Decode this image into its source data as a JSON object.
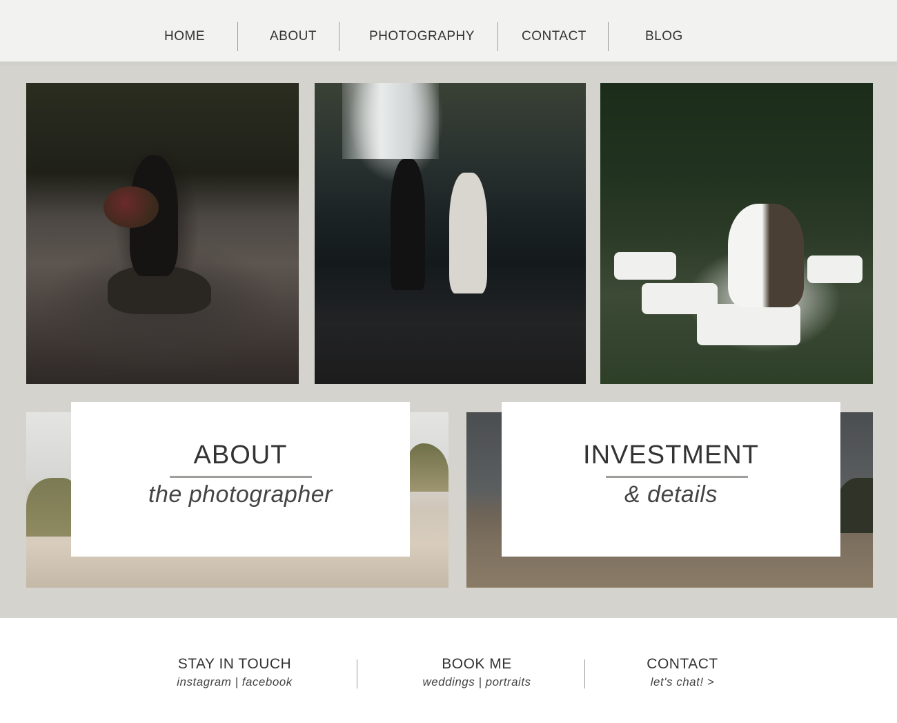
{
  "nav": {
    "items": [
      {
        "label": "HOME"
      },
      {
        "label": "ABOUT"
      },
      {
        "label": "PHOTOGRAPHY"
      },
      {
        "label": "CONTACT"
      },
      {
        "label": "BLOG"
      }
    ]
  },
  "gallery": {
    "photos": [
      {
        "alt": "bride-in-canyon"
      },
      {
        "alt": "couple-at-waterfall"
      },
      {
        "alt": "garden-reception-hug"
      }
    ]
  },
  "cards": {
    "about": {
      "title": "ABOUT",
      "subtitle": "the photographer"
    },
    "investment": {
      "title": "INVESTMENT",
      "subtitle": "& details"
    }
  },
  "footer": {
    "stay": {
      "title": "STAY IN TOUCH",
      "sub": "instagram | facebook"
    },
    "book": {
      "title": "BOOK ME",
      "sub": "weddings | portraits"
    },
    "contact": {
      "title": "CONTACT",
      "sub": "let's chat! >"
    }
  },
  "colors": {
    "nav_bg": "#f2f2f0",
    "main_bg": "#d4d3cd",
    "text": "#333333",
    "rule": "#9e9e9c"
  }
}
